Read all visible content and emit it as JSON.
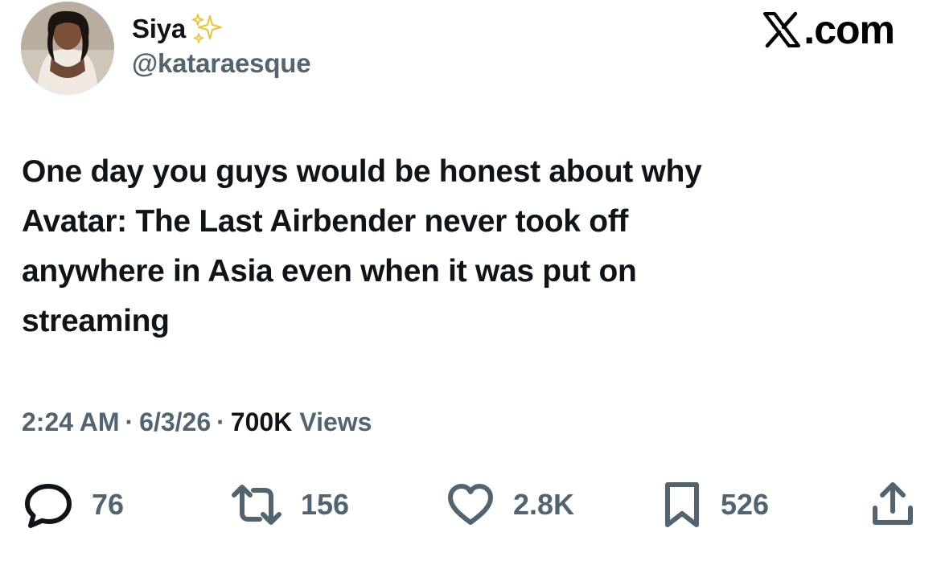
{
  "author": {
    "display_name": "Siya",
    "handle": "@kataraesque",
    "avatar_icon": "profile-photo",
    "badge_icon": "sparkles-icon"
  },
  "brand": {
    "logo_icon": "x-logo-icon",
    "domain": ".com"
  },
  "tweet": {
    "text": "One day you guys would be honest about why\nAvatar: The Last Airbender never took off\nanywhere in Asia even when it was put on\nstreaming"
  },
  "meta": {
    "time": "2:24 AM",
    "separator": "·",
    "date": "6/3/26",
    "views_count": "700K",
    "views_label": "Views"
  },
  "actions": {
    "reply": {
      "icon": "reply-icon",
      "count": "76"
    },
    "repost": {
      "icon": "repost-icon",
      "count": "156"
    },
    "like": {
      "icon": "heart-icon",
      "count": "2.8K"
    },
    "bookmark": {
      "icon": "bookmark-icon",
      "count": "526"
    },
    "share": {
      "icon": "share-icon"
    }
  },
  "colors": {
    "text_primary": "#0f1419",
    "text_secondary": "#536471",
    "sparkle": "#f2c230",
    "background": "#ffffff"
  }
}
